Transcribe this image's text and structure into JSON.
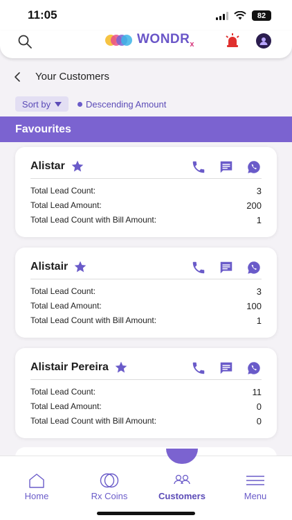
{
  "status": {
    "time": "11:05",
    "battery": "82"
  },
  "header": {
    "logo_text": "WONDR",
    "logo_sub": "x"
  },
  "page": {
    "title": "Your Customers"
  },
  "sort": {
    "label": "Sort by",
    "value": "Descending Amount"
  },
  "section": {
    "title": "Favourites"
  },
  "labels": {
    "lead_count": "Total Lead Count:",
    "lead_amount": "Total Lead Amount:",
    "bill_count": "Total Lead Count with Bill Amount:"
  },
  "customers": [
    {
      "name": "Alistar",
      "lead_count": "3",
      "lead_amount": "200",
      "bill_count": "1"
    },
    {
      "name": "Alistair",
      "lead_count": "3",
      "lead_amount": "100",
      "bill_count": "1"
    },
    {
      "name": "Alistair Pereira",
      "lead_count": "11",
      "lead_amount": "0",
      "bill_count": "0"
    }
  ],
  "nav": [
    {
      "label": "Home",
      "icon": "home-icon"
    },
    {
      "label": "Rx Coins",
      "icon": "coins-icon"
    },
    {
      "label": "Customers",
      "icon": "customers-icon",
      "active": true
    },
    {
      "label": "Menu",
      "icon": "menu-icon"
    }
  ],
  "colors": {
    "accent": "#7b63d0",
    "accent_dark": "#5b4bb7",
    "alarm": "#e0302e"
  }
}
